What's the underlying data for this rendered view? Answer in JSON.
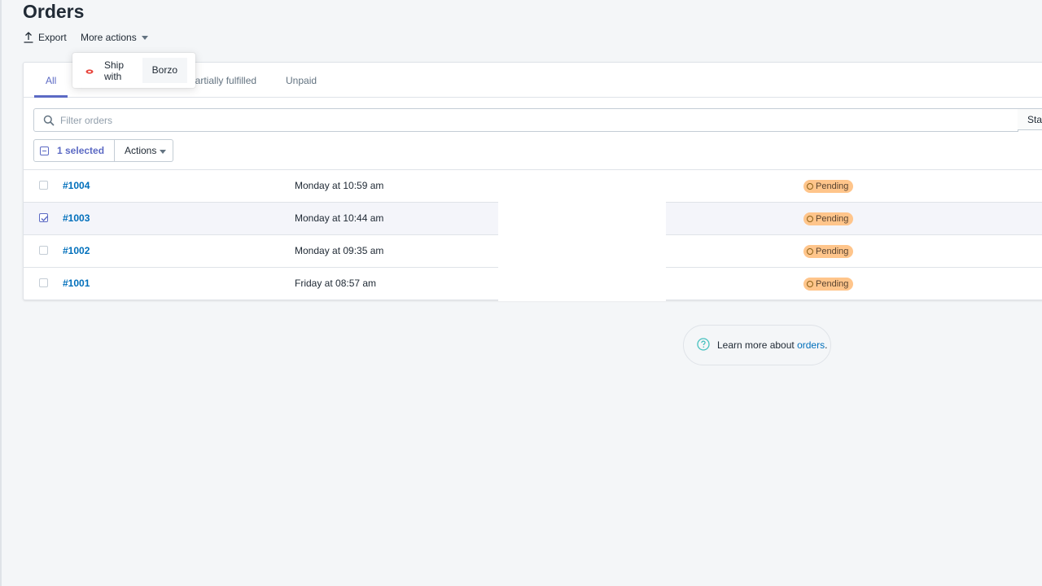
{
  "page": {
    "title": "Orders"
  },
  "toolbar": {
    "export_label": "Export",
    "more_actions_label": "More actions"
  },
  "dropdown": {
    "item_text": "Ship with",
    "item_brand": "Borzo"
  },
  "tabs": [
    {
      "label": "All",
      "active": true
    },
    {
      "label": "d partially fulfilled"
    },
    {
      "label": "Unpaid"
    }
  ],
  "filter": {
    "placeholder": "Filter orders",
    "status_label": "Sta"
  },
  "bulk": {
    "selected_label": "1 selected",
    "actions_label": "Actions"
  },
  "orders": [
    {
      "id": "#1004",
      "date": "Monday at 10:59 am",
      "status": "Pending",
      "checked": false
    },
    {
      "id": "#1003",
      "date": "Monday at 10:44 am",
      "status": "Pending",
      "checked": true
    },
    {
      "id": "#1002",
      "date": "Monday at 09:35 am",
      "status": "Pending",
      "checked": false
    },
    {
      "id": "#1001",
      "date": "Friday at 08:57 am",
      "status": "Pending",
      "checked": false
    }
  ],
  "help": {
    "text": "Learn more about ",
    "link": "orders",
    "suffix": "."
  },
  "colors": {
    "accent": "#5c6ac4",
    "link": "#006fbb",
    "pending_badge": "#ffc58b"
  },
  "icons": {
    "export": "export-icon",
    "caret": "caret-down-icon",
    "search": "search-icon",
    "help": "help-circle-icon",
    "brand": "borzo-logo-icon"
  }
}
